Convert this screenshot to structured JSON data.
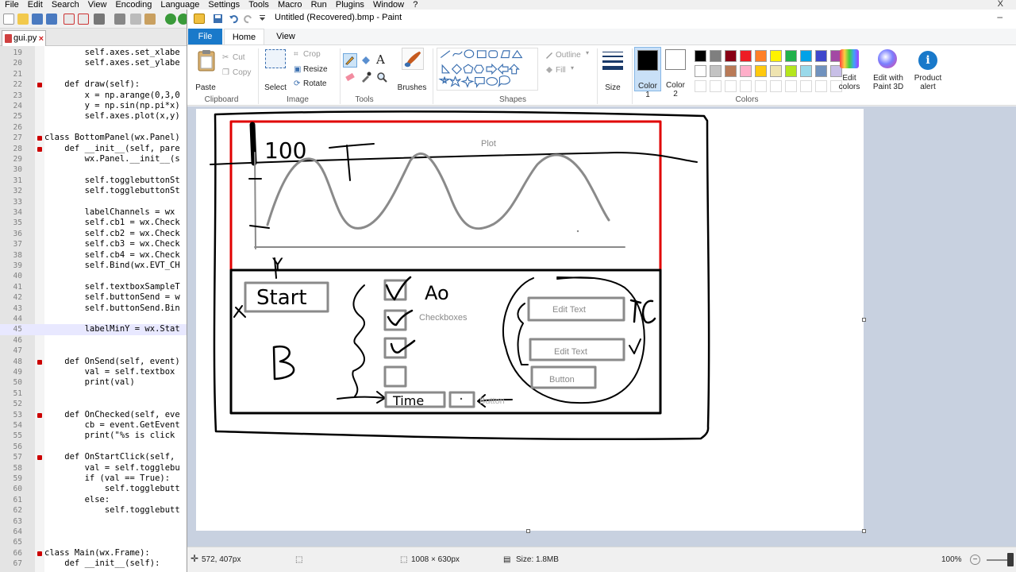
{
  "npp": {
    "menu": [
      "File",
      "Edit",
      "Search",
      "View",
      "Encoding",
      "Language",
      "Settings",
      "Tools",
      "Macro",
      "Run",
      "Plugins",
      "Window",
      "?"
    ],
    "close": "X",
    "tab_label": "gui.py",
    "tab_close": "×",
    "lines": [
      {
        "n": "19",
        "code": "        self.axes.set_xlabe"
      },
      {
        "n": "20",
        "code": "        self.axes.set_ylabe"
      },
      {
        "n": "21",
        "code": ""
      },
      {
        "n": "22",
        "code": "    def draw(self):"
      },
      {
        "n": "23",
        "code": "        x = np.arange(0,3,0"
      },
      {
        "n": "24",
        "code": "        y = np.sin(np.pi*x)"
      },
      {
        "n": "25",
        "code": "        self.axes.plot(x,y)"
      },
      {
        "n": "26",
        "code": ""
      },
      {
        "n": "27",
        "code": "class BottomPanel(wx.Panel)"
      },
      {
        "n": "28",
        "code": "    def __init__(self, pare"
      },
      {
        "n": "29",
        "code": "        wx.Panel.__init__(s"
      },
      {
        "n": "30",
        "code": ""
      },
      {
        "n": "31",
        "code": "        self.togglebuttonSt"
      },
      {
        "n": "32",
        "code": "        self.togglebuttonSt"
      },
      {
        "n": "33",
        "code": ""
      },
      {
        "n": "34",
        "code": "        labelChannels = wx"
      },
      {
        "n": "35",
        "code": "        self.cb1 = wx.Check"
      },
      {
        "n": "36",
        "code": "        self.cb2 = wx.Check"
      },
      {
        "n": "37",
        "code": "        self.cb3 = wx.Check"
      },
      {
        "n": "38",
        "code": "        self.cb4 = wx.Check"
      },
      {
        "n": "39",
        "code": "        self.Bind(wx.EVT_CH"
      },
      {
        "n": "40",
        "code": ""
      },
      {
        "n": "41",
        "code": "        self.textboxSampleT"
      },
      {
        "n": "42",
        "code": "        self.buttonSend = w"
      },
      {
        "n": "43",
        "code": "        self.buttonSend.Bin"
      },
      {
        "n": "44",
        "code": ""
      },
      {
        "n": "45",
        "code": "        labelMinY = wx.Stat"
      },
      {
        "n": "46",
        "code": ""
      },
      {
        "n": "47",
        "code": ""
      },
      {
        "n": "48",
        "code": "    def OnSend(self, event)"
      },
      {
        "n": "49",
        "code": "        val = self.textbox"
      },
      {
        "n": "50",
        "code": "        print(val)"
      },
      {
        "n": "51",
        "code": ""
      },
      {
        "n": "52",
        "code": ""
      },
      {
        "n": "53",
        "code": "    def OnChecked(self, eve"
      },
      {
        "n": "54",
        "code": "        cb = event.GetEvent"
      },
      {
        "n": "55",
        "code": "        print(\"%s is click"
      },
      {
        "n": "56",
        "code": ""
      },
      {
        "n": "57",
        "code": "    def OnStartClick(self, "
      },
      {
        "n": "58",
        "code": "        val = self.togglebu"
      },
      {
        "n": "59",
        "code": "        if (val == True):"
      },
      {
        "n": "60",
        "code": "            self.togglebutt"
      },
      {
        "n": "61",
        "code": "        else:"
      },
      {
        "n": "62",
        "code": "            self.togglebutt"
      },
      {
        "n": "63",
        "code": ""
      },
      {
        "n": "64",
        "code": ""
      },
      {
        "n": "65",
        "code": ""
      },
      {
        "n": "66",
        "code": "class Main(wx.Frame):"
      },
      {
        "n": "67",
        "code": "    def __init__(self):"
      }
    ]
  },
  "paint": {
    "title": "Untitled (Recovered).bmp - Paint",
    "min": "–",
    "tabs": {
      "file": "File",
      "home": "Home",
      "view": "View"
    },
    "clipboard": {
      "paste": "Paste",
      "cut": "Cut",
      "copy": "Copy",
      "label": "Clipboard"
    },
    "image": {
      "select": "Select",
      "crop": "Crop",
      "resize": "Resize",
      "rotate": "Rotate",
      "label": "Image"
    },
    "tools": {
      "label": "Tools",
      "text_glyph": "A"
    },
    "brushes": "Brushes",
    "shapes": {
      "outline": "Outline",
      "fill": "Fill",
      "label": "Shapes"
    },
    "size": "Size",
    "color1": "Color 1",
    "color2": "Color 2",
    "colors_label": "Colors",
    "edit_colors": "Edit colors",
    "paint3d": "Edit with Paint 3D",
    "product_alert": "Product alert",
    "info_glyph": "i",
    "palette_row1": [
      "#000000",
      "#7f7f7f",
      "#880015",
      "#ed1c24",
      "#ff7f27",
      "#fff200",
      "#22b14c",
      "#00a2e8",
      "#3f48cc",
      "#a349a4"
    ],
    "palette_row2": [
      "#ffffff",
      "#c3c3c3",
      "#b97a57",
      "#ffaec9",
      "#ffc90e",
      "#efe4b0",
      "#b5e61d",
      "#99d9ea",
      "#7092be",
      "#c8bfe7"
    ],
    "color1_value": "#000000",
    "color2_value": "#ffffff"
  },
  "sketch": {
    "num_100": "100",
    "plot_label": "Plot",
    "y_label": "Y",
    "start": "Start",
    "ao": "Ao",
    "checkboxes": "Checkboxes",
    "b_label": "B",
    "edit_text_1": "Edit Text",
    "edit_text_2": "Edit Text",
    "button_label": "Button",
    "time": "Time",
    "button_faded": "Button",
    "tc": "TC"
  },
  "status": {
    "cursor_pos": "572, 407px",
    "canvas_size": "1008 × 630px",
    "file_size": "Size: 1.8MB",
    "zoom": "100%",
    "zoom_out": "−"
  }
}
